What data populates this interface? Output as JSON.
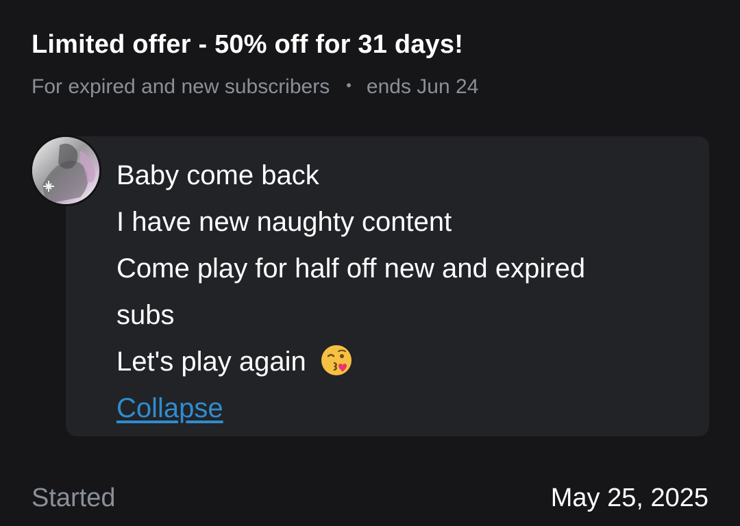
{
  "offer": {
    "title": "Limited offer - 50% off for 31 days!",
    "audience": "For expired and new subscribers",
    "separator": "•",
    "ends": "ends Jun 24"
  },
  "message": {
    "avatar_icon": "profile-avatar",
    "lines": [
      "Baby come back",
      "I have new naughty content",
      "Come play for half off new and expired",
      "subs",
      "Let's play again"
    ],
    "emoji": "face-blowing-a-kiss-icon",
    "collapse_label": "Collapse"
  },
  "footer": {
    "started_label": "Started",
    "started_date": "May 25, 2025"
  },
  "colors": {
    "background": "#161618",
    "card": "#222327",
    "muted_text": "#8a9099",
    "link": "#2f8ccf"
  }
}
